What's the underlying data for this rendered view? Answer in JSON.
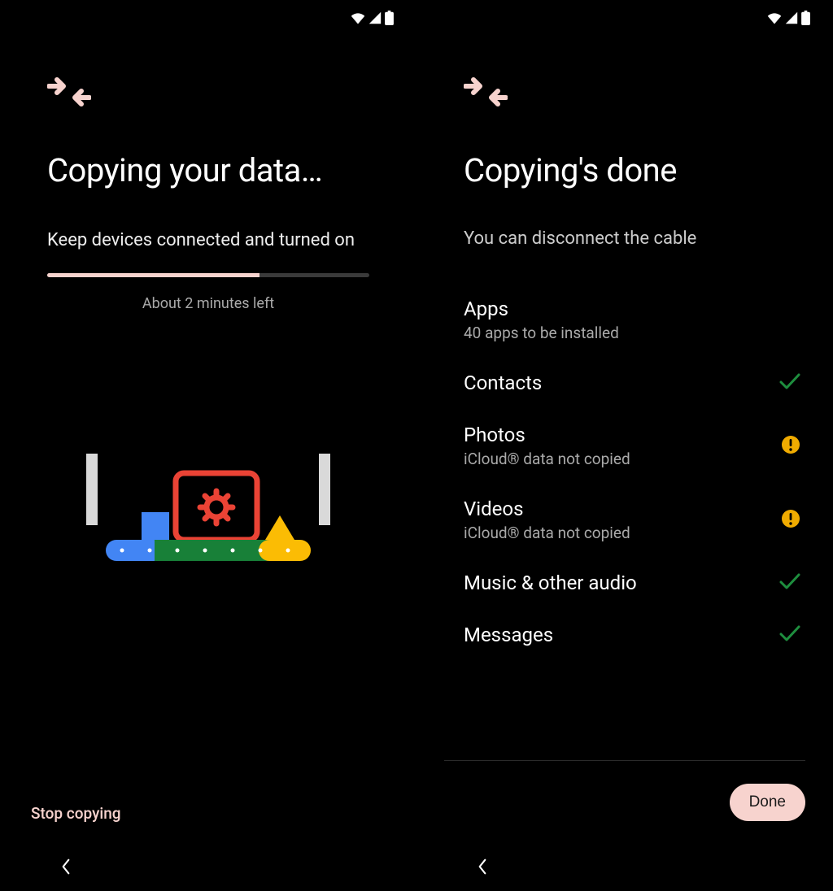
{
  "colors": {
    "accent": "#f7d3ce",
    "warning": "#f0ab00",
    "success": "#1e8e3e"
  },
  "left": {
    "title": "Copying your data…",
    "subtitle": "Keep devices connected and turned on",
    "time_remaining": "About 2 minutes left",
    "progress_percent": 66,
    "stop_label": "Stop copying"
  },
  "right": {
    "title": "Copying's done",
    "subtitle": "You can disconnect the cable",
    "done_label": "Done",
    "items": [
      {
        "label": "Apps",
        "sub": "40 apps to be installed",
        "status": "none"
      },
      {
        "label": "Contacts",
        "sub": "",
        "status": "check"
      },
      {
        "label": "Photos",
        "sub": "iCloud® data not copied",
        "status": "warn"
      },
      {
        "label": "Videos",
        "sub": "iCloud® data not copied",
        "status": "warn"
      },
      {
        "label": "Music & other audio",
        "sub": "",
        "status": "check"
      },
      {
        "label": "Messages",
        "sub": "",
        "status": "check"
      }
    ]
  }
}
